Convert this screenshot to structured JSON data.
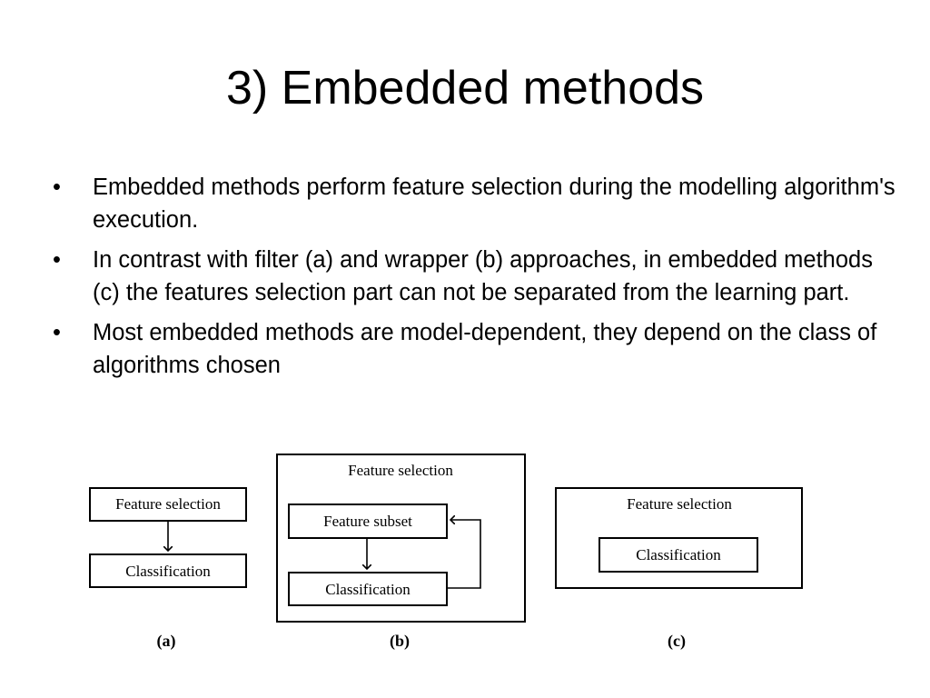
{
  "slide": {
    "title": "3) Embedded methods",
    "bullets": [
      "Embedded methods perform feature selection during the modelling algorithm's execution.",
      "In contrast with filter (a)  and wrapper (b) approaches, in embedded methods (c) the features selection part can not be separated from the learning part.",
      "Most embedded methods are model-dependent, they depend on the class of algorithms chosen"
    ],
    "bullet_glyph": "•"
  },
  "diagram": {
    "a": {
      "feature_selection": "Feature selection",
      "classification": "Classification",
      "label": "(a)"
    },
    "b": {
      "outer": "Feature selection",
      "feature_subset": "Feature subset",
      "classification": "Classification",
      "label": "(b)"
    },
    "c": {
      "outer": "Feature selection",
      "classification": "Classification",
      "label": "(c)"
    }
  }
}
